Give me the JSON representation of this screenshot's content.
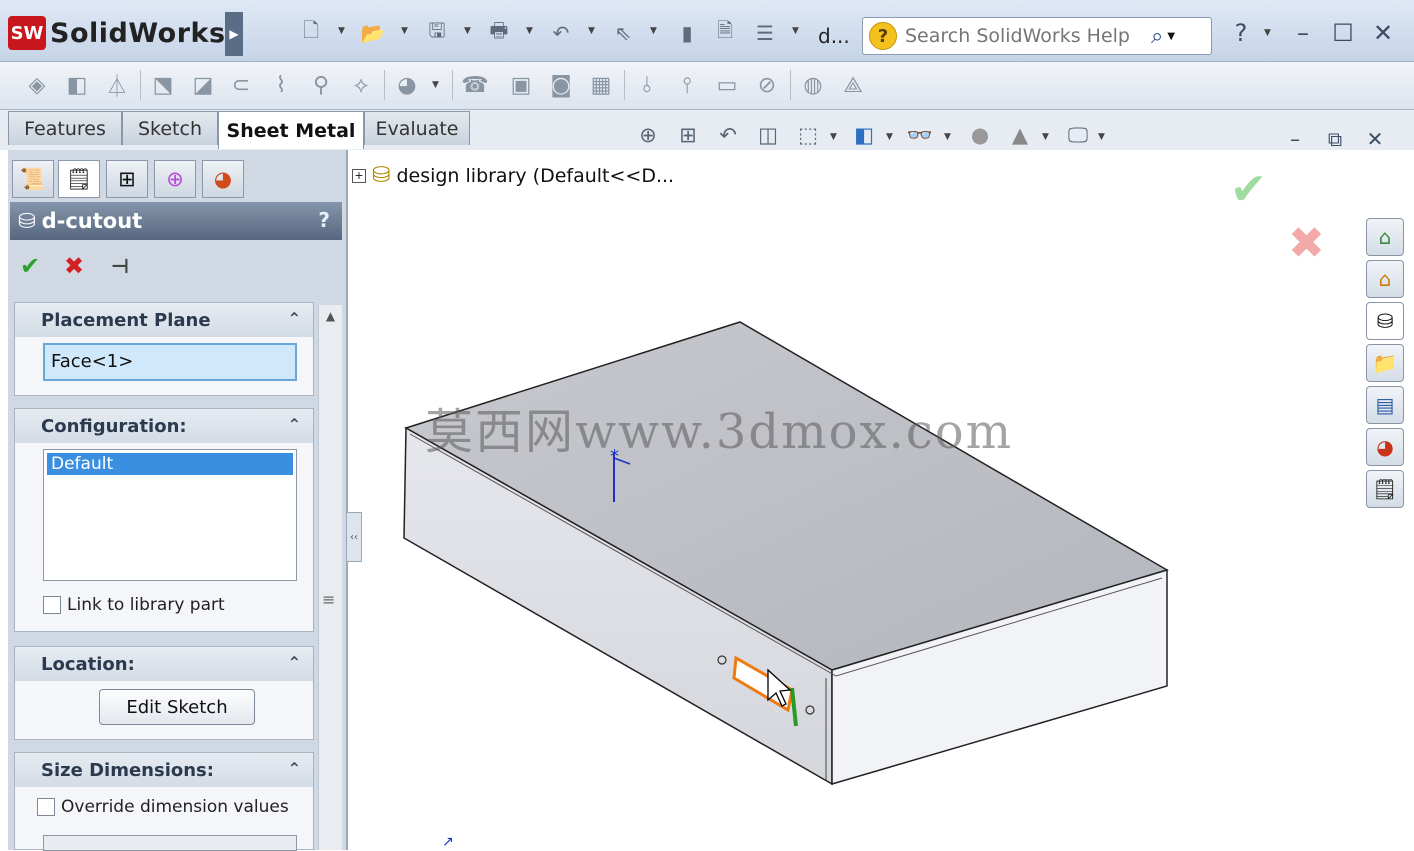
{
  "app": {
    "brand": "SolidWorks",
    "logo_mark": "SW",
    "doc_name": "d..."
  },
  "help": {
    "placeholder": "Search SolidWorks Help"
  },
  "tabs": [
    "Features",
    "Sketch",
    "Sheet Metal",
    "Evaluate"
  ],
  "active_tab": "Sheet Metal",
  "feature": {
    "title": "d-cutout",
    "help": "?"
  },
  "placement_plane": {
    "title": "Placement Plane",
    "value": "Face<1>"
  },
  "configuration": {
    "title": "Configuration:",
    "selected": "Default",
    "link_label": "Link to library part"
  },
  "location": {
    "title": "Location:",
    "edit_sketch": "Edit Sketch"
  },
  "size_dimensions": {
    "title": "Size Dimensions:",
    "override_label": "Override dimension values"
  },
  "tree": {
    "label": "design library  (Default<<D...",
    "expand": "+"
  },
  "watermark": "莫西网www.3dmox.com",
  "colors": {
    "accent": "#3b8fe0",
    "ok": "#2aa12a",
    "cancel": "#d42020",
    "title_bar": "#c6d4e8"
  },
  "icons": {
    "new": "new-document-icon",
    "open": "open-icon",
    "save": "save-icon",
    "print": "print-icon",
    "undo": "undo-icon",
    "select": "select-icon",
    "rebuild": "rebuild-icon",
    "options": "options-icon"
  }
}
